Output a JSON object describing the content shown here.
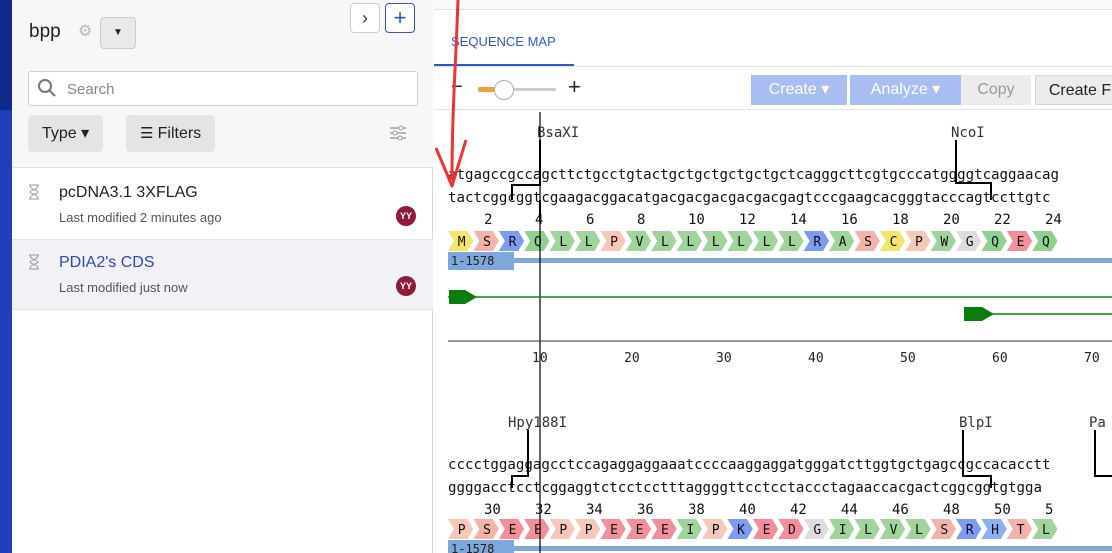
{
  "sidebar": {
    "project_title": "bpp",
    "search_placeholder": "Search",
    "type_label": "Type ▾",
    "filters_label": "Filters",
    "files": [
      {
        "name": "pcDNA3.1 3XFLAG",
        "meta": "Last modified 2 minutes ago",
        "avatar": "YY"
      },
      {
        "name": "PDIA2's CDS",
        "meta": "Last modified just now",
        "avatar": "YY"
      }
    ]
  },
  "main": {
    "tab": "SEQUENCE MAP",
    "zoom_minus": "−",
    "zoom_plus": "+",
    "zoom_level": 0.22,
    "toolbar": {
      "create": "Create ▾",
      "analyze": "Analyze ▾",
      "copy": "Copy",
      "create_f": "Create F"
    },
    "block1": {
      "enzymes": [
        "BsaXI",
        "NcoI"
      ],
      "top_seq": "atgagccgccagcttctgcctgtactgctgctgctgctgctcagggcttcgtgcccatggggtcaggaacag",
      "bottom_seq": "tactcggcggtcgaagacggacatgacgacgacgacgacgagtcccgaagcacgggtacccagtccttgtc",
      "aa_numbers": [
        "2",
        "4",
        "6",
        "8",
        "10",
        "12",
        "14",
        "16",
        "18",
        "20",
        "22",
        "24"
      ],
      "aas": [
        "M",
        "S",
        "R",
        "Q",
        "L",
        "L",
        "P",
        "V",
        "L",
        "L",
        "L",
        "L",
        "L",
        "L",
        "R",
        "A",
        "S",
        "C",
        "P",
        "W",
        "G",
        "Q",
        "E",
        "Q"
      ],
      "feature": "1-1578",
      "ruler": [
        "10",
        "20",
        "30",
        "40",
        "50",
        "60",
        "70"
      ]
    },
    "block2": {
      "enzymes": [
        "Hpy188I",
        "BlpI",
        "Pa"
      ],
      "top_seq": "cccctggaggagcctccagaggaggaaatccccaaggaggatgggatcttggtgctgagccgccacacctt",
      "bottom_seq": "ggggacctcctcggaggtctcctcctttaggggttcctcctaccctagaaccacgactcggcggtgtgga",
      "aa_numbers": [
        "30",
        "32",
        "34",
        "36",
        "38",
        "40",
        "42",
        "44",
        "46",
        "48",
        "50",
        "5"
      ],
      "aas": [
        "P",
        "S",
        "E",
        "E",
        "P",
        "P",
        "E",
        "E",
        "E",
        "I",
        "P",
        "K",
        "E",
        "D",
        "G",
        "I",
        "L",
        "V",
        "L",
        "S",
        "R",
        "H",
        "T",
        "L"
      ],
      "feature": "1-1578"
    },
    "colors": {
      "aa_M": "#f5e56b",
      "aa_S": "#f4b3a8",
      "aa_R": "#7d9bf0",
      "aa_Q": "#8fd18e",
      "aa_L": "#9fd49b",
      "aa_P": "#f7c8b7",
      "aa_V": "#9fd49b",
      "aa_A": "#9fd49b",
      "aa_C": "#f4e66b",
      "aa_W": "#9fd49b",
      "aa_G": "#dddddd",
      "aa_E": "#f48f99",
      "aa_I": "#9fd49b",
      "aa_K": "#7d9bf0",
      "aa_D": "#f48f99",
      "aa_H": "#8ab0f4",
      "aa_T": "#f4b3a8",
      "feature": "#7ea7dc"
    }
  }
}
